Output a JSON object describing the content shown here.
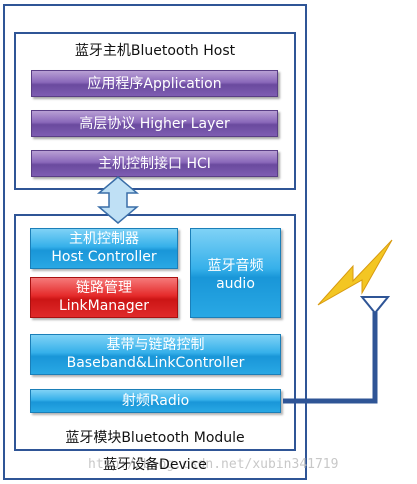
{
  "device": {
    "label": "蓝牙设备Device"
  },
  "host": {
    "label": "蓝牙主机Bluetooth Host",
    "layers": [
      {
        "label": "应用程序Application"
      },
      {
        "label": "高层协议 Higher Layer"
      },
      {
        "label": "主机控制接口 HCI"
      }
    ]
  },
  "module": {
    "label": "蓝牙模块Bluetooth Module",
    "host_controller": {
      "line1": "主机控制器",
      "line2": "Host Controller"
    },
    "link_manager": {
      "line1": "链路管理",
      "line2": "LinkManager"
    },
    "audio": {
      "line1": "蓝牙音频",
      "line2": "audio"
    },
    "baseband": {
      "line1": "基带与链路控制",
      "line2": "Baseband&LinkController"
    },
    "radio": {
      "label": "射频Radio"
    }
  },
  "watermark": {
    "text": "http://blog.csdn.net/xubin341719"
  },
  "colors": {
    "border": "#2f5596",
    "purple": "#7e5db2",
    "blue": "#29a8e4",
    "red": "#e02a2a",
    "lightning": "#f0c020"
  },
  "icons": [
    "double-arrow-icon",
    "lightning-icon",
    "antenna-icon"
  ]
}
